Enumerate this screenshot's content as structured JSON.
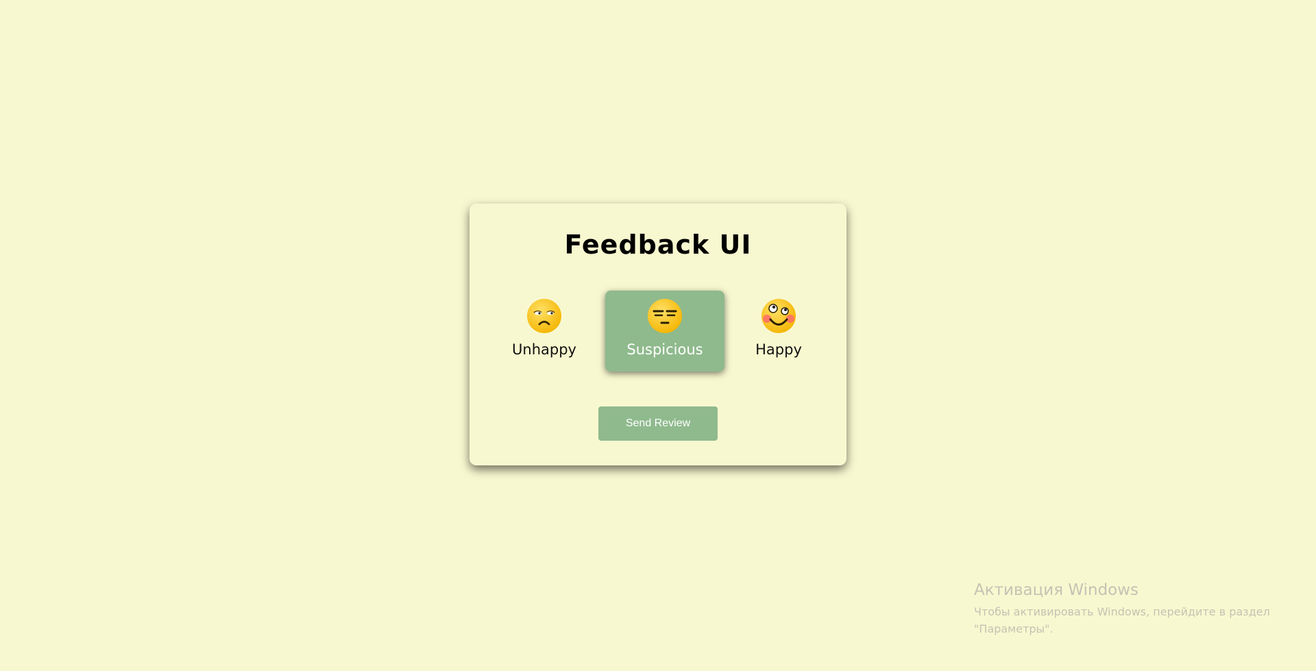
{
  "card": {
    "title": "Feedback UI",
    "options": [
      {
        "label": "Unhappy",
        "icon": "unhappy-face-icon",
        "selected": false
      },
      {
        "label": "Suspicious",
        "icon": "expressionless-face-icon",
        "selected": true
      },
      {
        "label": "Happy",
        "icon": "happy-face-icon",
        "selected": false
      }
    ],
    "send_label": "Send Review"
  },
  "watermark": {
    "title": "Активация Windows",
    "line1": "Чтобы активировать Windows, перейдите в раздел",
    "line2": "\"Параметры\"."
  },
  "colors": {
    "background": "#f8f8d0",
    "accent": "#8fba8d",
    "emoji_yellow": "#ffd02f"
  }
}
